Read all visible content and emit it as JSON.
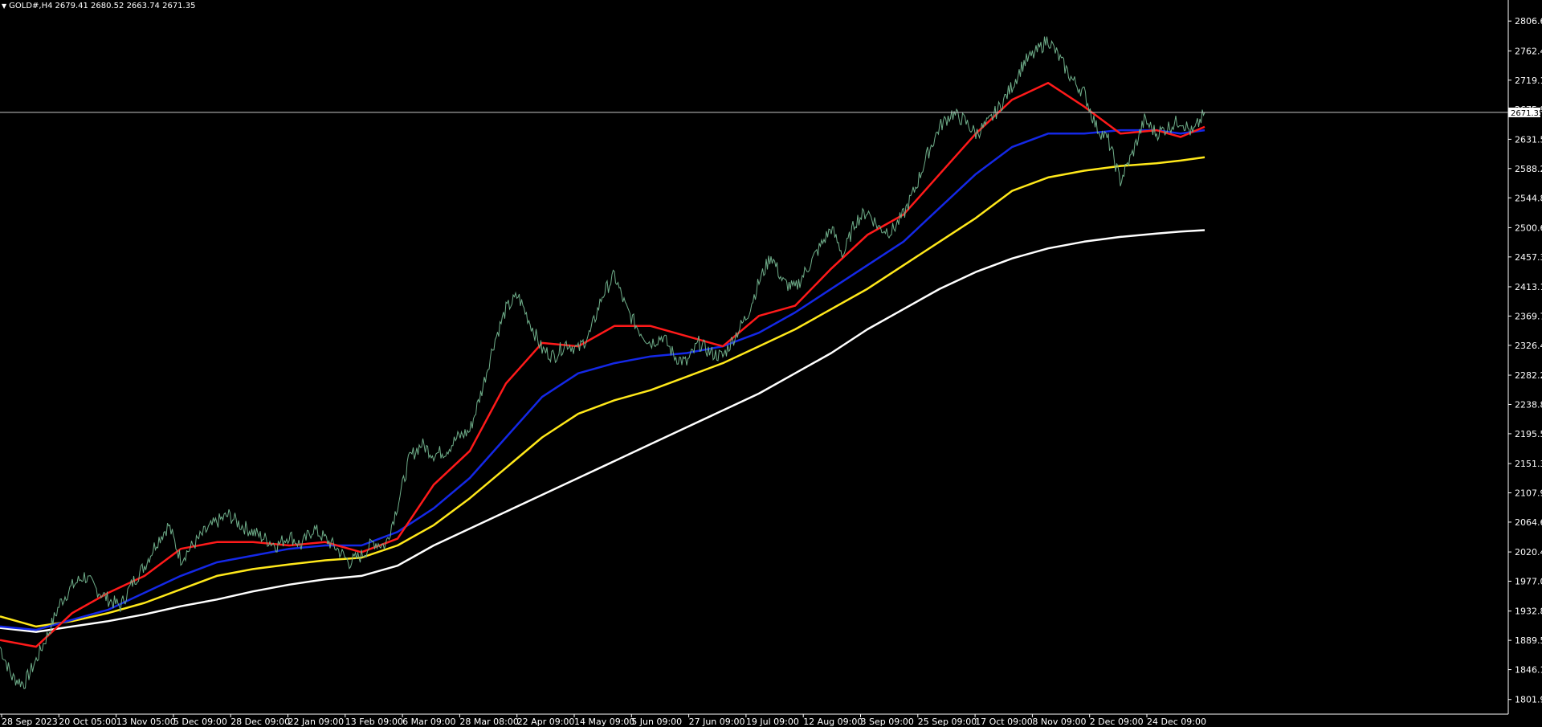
{
  "header": {
    "symbol": "GOLD#,H4",
    "ohlc": "2679.41 2680.52 2663.74 2671.35",
    "menu_icon": "triangle-down-icon"
  },
  "chart_data": {
    "type": "line",
    "title": "",
    "symbol": "GOLD#",
    "timeframe": "H4",
    "current_price": 2671.35,
    "current_price_label": "2671.35",
    "ylim": [
      1780.2,
      2828.3
    ],
    "y_ticks": [
      "2806.65",
      "2762.45",
      "2719.10",
      "2675.80",
      "2631.55",
      "2588.20",
      "2544.85",
      "2500.65",
      "2457.30",
      "2413.10",
      "2369.75",
      "2326.40",
      "2282.20",
      "2238.85",
      "2195.50",
      "2151.30",
      "2107.95",
      "2064.60",
      "2020.40",
      "1977.05",
      "1932.85",
      "1889.50",
      "1846.15",
      "1801.95"
    ],
    "x_ticks": [
      "28 Sep 2023",
      "20 Oct 05:00",
      "13 Nov 05:00",
      "5 Dec 09:00",
      "28 Dec 09:00",
      "22 Jan 09:00",
      "13 Feb 09:00",
      "6 Mar 09:00",
      "28 Mar 08:00",
      "22 Apr 09:00",
      "14 May 09:00",
      "5 Jun 09:00",
      "27 Jun 09:00",
      "19 Jul 09:00",
      "12 Aug 09:00",
      "3 Sep 09:00",
      "25 Sep 09:00",
      "17 Oct 09:00",
      "8 Nov 09:00",
      "2 Dec 09:00",
      "24 Dec 09:00"
    ],
    "x_range": [
      0,
      1.0
    ],
    "price_path": [
      [
        0.0,
        1880
      ],
      [
        0.01,
        1835
      ],
      [
        0.02,
        1825
      ],
      [
        0.03,
        1860
      ],
      [
        0.04,
        1900
      ],
      [
        0.05,
        1945
      ],
      [
        0.06,
        1970
      ],
      [
        0.07,
        1985
      ],
      [
        0.08,
        1965
      ],
      [
        0.09,
        1950
      ],
      [
        0.1,
        1940
      ],
      [
        0.11,
        1975
      ],
      [
        0.12,
        2000
      ],
      [
        0.13,
        2035
      ],
      [
        0.14,
        2060
      ],
      [
        0.15,
        2010
      ],
      [
        0.16,
        2030
      ],
      [
        0.17,
        2050
      ],
      [
        0.18,
        2065
      ],
      [
        0.19,
        2075
      ],
      [
        0.2,
        2060
      ],
      [
        0.21,
        2050
      ],
      [
        0.22,
        2040
      ],
      [
        0.23,
        2030
      ],
      [
        0.24,
        2045
      ],
      [
        0.25,
        2030
      ],
      [
        0.26,
        2055
      ],
      [
        0.27,
        2040
      ],
      [
        0.28,
        2025
      ],
      [
        0.29,
        2005
      ],
      [
        0.3,
        2015
      ],
      [
        0.31,
        2035
      ],
      [
        0.32,
        2030
      ],
      [
        0.33,
        2090
      ],
      [
        0.34,
        2160
      ],
      [
        0.35,
        2180
      ],
      [
        0.36,
        2165
      ],
      [
        0.37,
        2170
      ],
      [
        0.38,
        2190
      ],
      [
        0.39,
        2200
      ],
      [
        0.4,
        2260
      ],
      [
        0.41,
        2330
      ],
      [
        0.42,
        2380
      ],
      [
        0.43,
        2400
      ],
      [
        0.44,
        2360
      ],
      [
        0.45,
        2320
      ],
      [
        0.46,
        2310
      ],
      [
        0.47,
        2330
      ],
      [
        0.48,
        2320
      ],
      [
        0.49,
        2345
      ],
      [
        0.5,
        2400
      ],
      [
        0.51,
        2430
      ],
      [
        0.52,
        2380
      ],
      [
        0.53,
        2350
      ],
      [
        0.54,
        2330
      ],
      [
        0.55,
        2340
      ],
      [
        0.56,
        2310
      ],
      [
        0.57,
        2300
      ],
      [
        0.58,
        2330
      ],
      [
        0.59,
        2315
      ],
      [
        0.6,
        2310
      ],
      [
        0.61,
        2340
      ],
      [
        0.62,
        2370
      ],
      [
        0.63,
        2420
      ],
      [
        0.64,
        2460
      ],
      [
        0.65,
        2420
      ],
      [
        0.66,
        2410
      ],
      [
        0.67,
        2440
      ],
      [
        0.68,
        2470
      ],
      [
        0.69,
        2500
      ],
      [
        0.7,
        2460
      ],
      [
        0.71,
        2510
      ],
      [
        0.72,
        2525
      ],
      [
        0.73,
        2500
      ],
      [
        0.74,
        2495
      ],
      [
        0.75,
        2520
      ],
      [
        0.76,
        2560
      ],
      [
        0.77,
        2610
      ],
      [
        0.78,
        2650
      ],
      [
        0.79,
        2670
      ],
      [
        0.8,
        2660
      ],
      [
        0.81,
        2640
      ],
      [
        0.82,
        2655
      ],
      [
        0.83,
        2680
      ],
      [
        0.84,
        2710
      ],
      [
        0.85,
        2745
      ],
      [
        0.86,
        2760
      ],
      [
        0.87,
        2780
      ],
      [
        0.88,
        2750
      ],
      [
        0.89,
        2720
      ],
      [
        0.9,
        2700
      ],
      [
        0.91,
        2650
      ],
      [
        0.92,
        2630
      ],
      [
        0.93,
        2570
      ],
      [
        0.94,
        2610
      ],
      [
        0.95,
        2660
      ],
      [
        0.96,
        2640
      ],
      [
        0.97,
        2650
      ],
      [
        0.98,
        2660
      ],
      [
        0.99,
        2640
      ],
      [
        1.0,
        2671
      ]
    ],
    "series": [
      {
        "color": "#ff1a1a",
        "values": [
          [
            0.0,
            1890
          ],
          [
            0.03,
            1880
          ],
          [
            0.06,
            1930
          ],
          [
            0.09,
            1960
          ],
          [
            0.12,
            1985
          ],
          [
            0.15,
            2025
          ],
          [
            0.18,
            2035
          ],
          [
            0.21,
            2035
          ],
          [
            0.24,
            2030
          ],
          [
            0.27,
            2035
          ],
          [
            0.3,
            2020
          ],
          [
            0.33,
            2040
          ],
          [
            0.36,
            2120
          ],
          [
            0.39,
            2170
          ],
          [
            0.42,
            2270
          ],
          [
            0.45,
            2330
          ],
          [
            0.48,
            2325
          ],
          [
            0.51,
            2355
          ],
          [
            0.54,
            2355
          ],
          [
            0.57,
            2340
          ],
          [
            0.6,
            2325
          ],
          [
            0.63,
            2370
          ],
          [
            0.66,
            2385
          ],
          [
            0.69,
            2440
          ],
          [
            0.72,
            2490
          ],
          [
            0.75,
            2520
          ],
          [
            0.78,
            2580
          ],
          [
            0.81,
            2640
          ],
          [
            0.84,
            2690
          ],
          [
            0.87,
            2715
          ],
          [
            0.9,
            2680
          ],
          [
            0.93,
            2640
          ],
          [
            0.96,
            2645
          ],
          [
            0.98,
            2635
          ],
          [
            1.0,
            2650
          ]
        ]
      },
      {
        "color": "#1428e6",
        "values": [
          [
            0.0,
            1910
          ],
          [
            0.03,
            1905
          ],
          [
            0.06,
            1920
          ],
          [
            0.09,
            1935
          ],
          [
            0.12,
            1960
          ],
          [
            0.15,
            1985
          ],
          [
            0.18,
            2005
          ],
          [
            0.21,
            2015
          ],
          [
            0.24,
            2025
          ],
          [
            0.27,
            2030
          ],
          [
            0.3,
            2030
          ],
          [
            0.33,
            2050
          ],
          [
            0.36,
            2085
          ],
          [
            0.39,
            2130
          ],
          [
            0.42,
            2190
          ],
          [
            0.45,
            2250
          ],
          [
            0.48,
            2285
          ],
          [
            0.51,
            2300
          ],
          [
            0.54,
            2310
          ],
          [
            0.57,
            2315
          ],
          [
            0.6,
            2325
          ],
          [
            0.63,
            2345
          ],
          [
            0.66,
            2375
          ],
          [
            0.69,
            2410
          ],
          [
            0.72,
            2445
          ],
          [
            0.75,
            2480
          ],
          [
            0.78,
            2530
          ],
          [
            0.81,
            2580
          ],
          [
            0.84,
            2620
          ],
          [
            0.87,
            2640
          ],
          [
            0.9,
            2640
          ],
          [
            0.93,
            2645
          ],
          [
            0.96,
            2645
          ],
          [
            0.98,
            2640
          ],
          [
            1.0,
            2645
          ]
        ]
      },
      {
        "color": "#ffe81a",
        "values": [
          [
            0.0,
            1925
          ],
          [
            0.03,
            1910
          ],
          [
            0.06,
            1918
          ],
          [
            0.09,
            1930
          ],
          [
            0.12,
            1945
          ],
          [
            0.15,
            1965
          ],
          [
            0.18,
            1985
          ],
          [
            0.21,
            1995
          ],
          [
            0.24,
            2002
          ],
          [
            0.27,
            2008
          ],
          [
            0.3,
            2012
          ],
          [
            0.33,
            2030
          ],
          [
            0.36,
            2060
          ],
          [
            0.39,
            2100
          ],
          [
            0.42,
            2145
          ],
          [
            0.45,
            2190
          ],
          [
            0.48,
            2225
          ],
          [
            0.51,
            2245
          ],
          [
            0.54,
            2260
          ],
          [
            0.57,
            2280
          ],
          [
            0.6,
            2300
          ],
          [
            0.63,
            2325
          ],
          [
            0.66,
            2350
          ],
          [
            0.69,
            2380
          ],
          [
            0.72,
            2410
          ],
          [
            0.75,
            2445
          ],
          [
            0.78,
            2480
          ],
          [
            0.81,
            2515
          ],
          [
            0.84,
            2555
          ],
          [
            0.87,
            2575
          ],
          [
            0.9,
            2585
          ],
          [
            0.93,
            2592
          ],
          [
            0.96,
            2596
          ],
          [
            0.98,
            2600
          ],
          [
            1.0,
            2605
          ]
        ]
      },
      {
        "color": "#ffffff",
        "values": [
          [
            0.0,
            1908
          ],
          [
            0.03,
            1902
          ],
          [
            0.06,
            1910
          ],
          [
            0.09,
            1918
          ],
          [
            0.12,
            1928
          ],
          [
            0.15,
            1940
          ],
          [
            0.18,
            1950
          ],
          [
            0.21,
            1962
          ],
          [
            0.24,
            1972
          ],
          [
            0.27,
            1980
          ],
          [
            0.3,
            1985
          ],
          [
            0.33,
            2000
          ],
          [
            0.36,
            2030
          ],
          [
            0.39,
            2055
          ],
          [
            0.42,
            2080
          ],
          [
            0.45,
            2105
          ],
          [
            0.48,
            2130
          ],
          [
            0.51,
            2155
          ],
          [
            0.54,
            2180
          ],
          [
            0.57,
            2205
          ],
          [
            0.6,
            2230
          ],
          [
            0.63,
            2255
          ],
          [
            0.66,
            2285
          ],
          [
            0.69,
            2315
          ],
          [
            0.72,
            2350
          ],
          [
            0.75,
            2380
          ],
          [
            0.78,
            2410
          ],
          [
            0.81,
            2435
          ],
          [
            0.84,
            2455
          ],
          [
            0.87,
            2470
          ],
          [
            0.9,
            2480
          ],
          [
            0.93,
            2487
          ],
          [
            0.96,
            2492
          ],
          [
            0.98,
            2495
          ],
          [
            1.0,
            2497
          ]
        ]
      }
    ],
    "grid": false,
    "legend": "none"
  }
}
